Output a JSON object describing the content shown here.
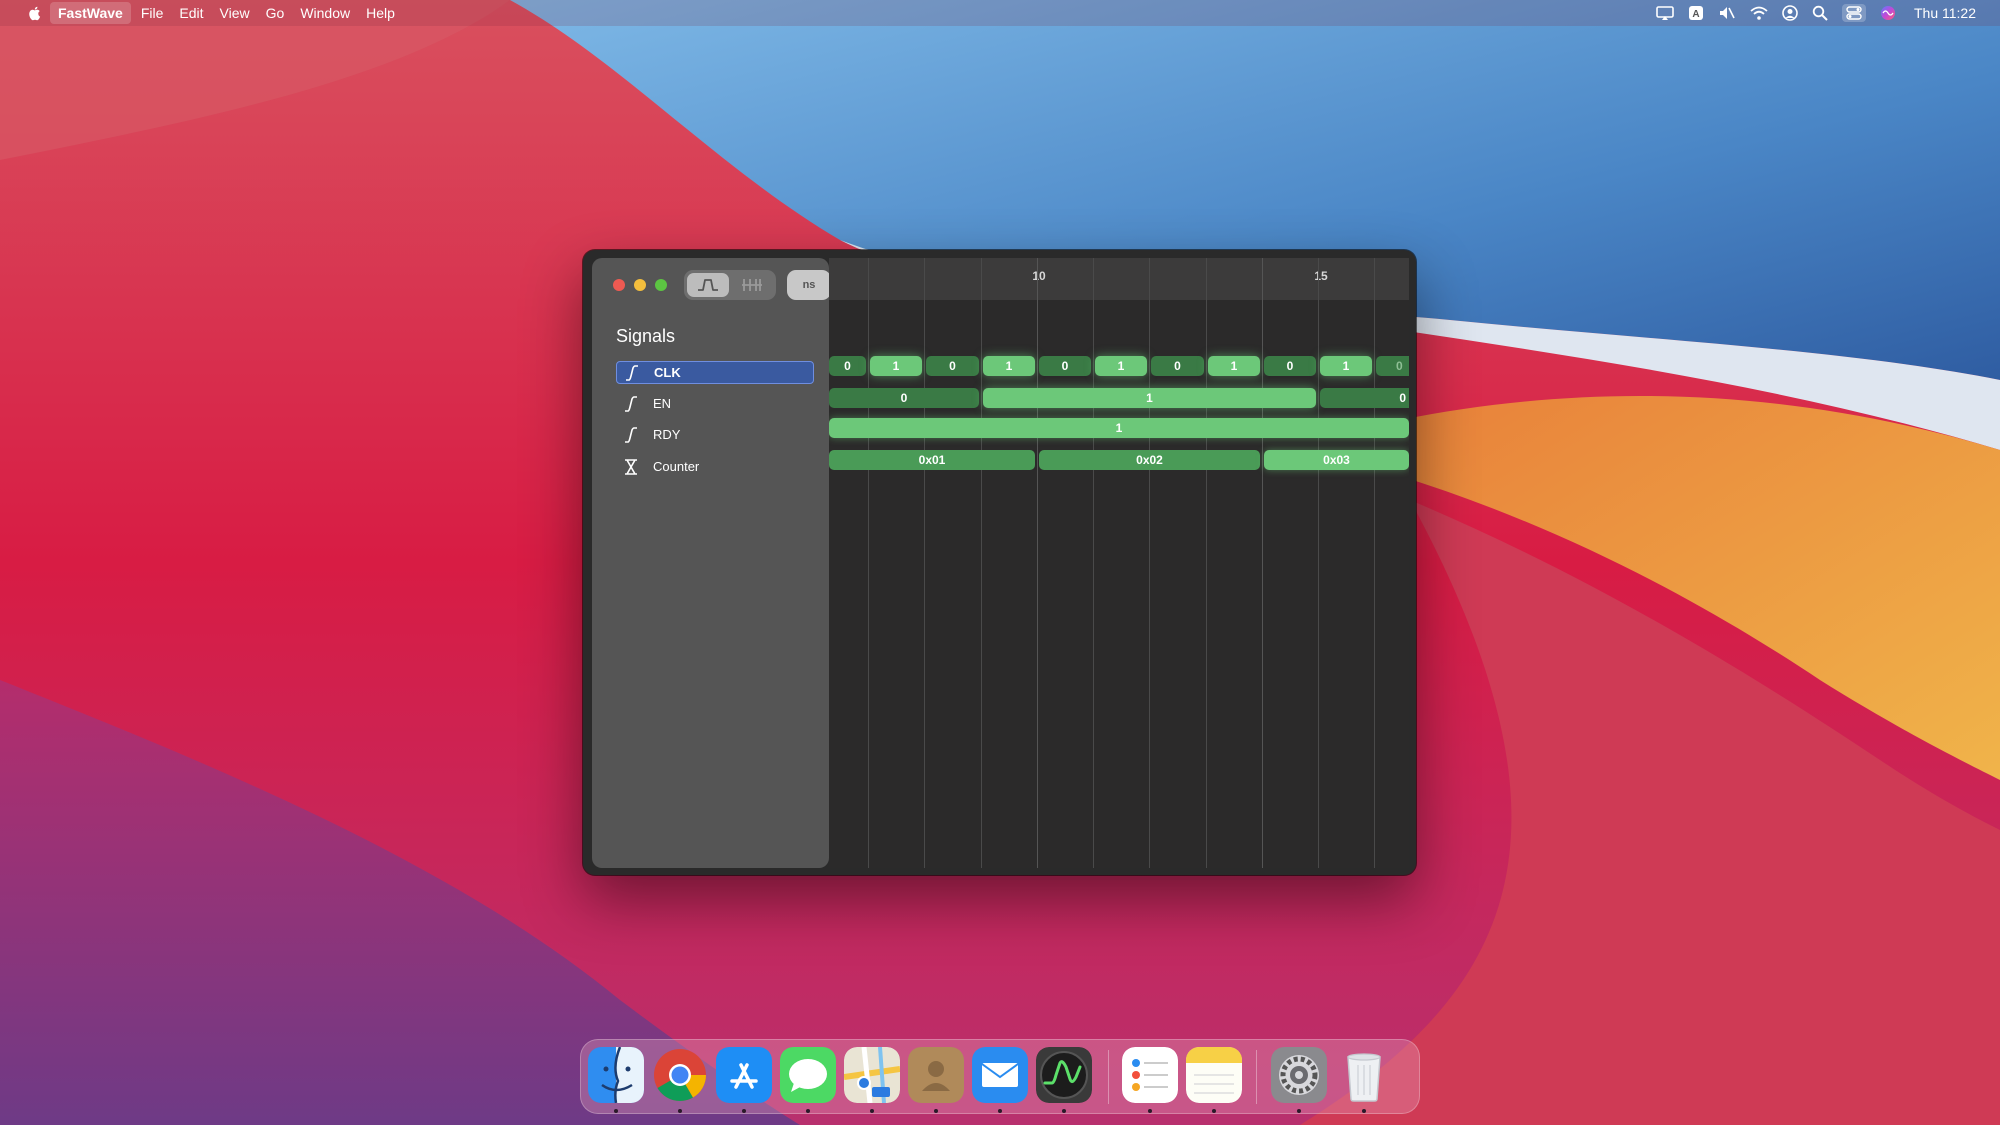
{
  "menubar": {
    "app_name": "FastWave",
    "menus": [
      "File",
      "Edit",
      "View",
      "Go",
      "Window",
      "Help"
    ],
    "clock": "Thu 11:22",
    "status_icons": [
      "screen-mirroring-icon",
      "keyboard-input-icon",
      "muted-volume-icon",
      "wifi-icon",
      "user-account-icon",
      "spotlight-search-icon",
      "control-center-icon",
      "siri-icon"
    ]
  },
  "window": {
    "toolbar": {
      "waveform_view_icon": "waveform-icon",
      "bus_view_icon": "bus-view-icon",
      "time_unit": "ns"
    },
    "sidebar": {
      "title": "Signals",
      "signals": [
        {
          "label": "CLK",
          "icon": "clock-signal-icon",
          "selected": true
        },
        {
          "label": "EN",
          "icon": "edge-signal-icon",
          "selected": false
        },
        {
          "label": "RDY",
          "icon": "edge-signal-icon",
          "selected": false
        },
        {
          "label": "Counter",
          "icon": "bus-signal-icon",
          "selected": false
        }
      ]
    },
    "ruler": {
      "labels": [
        "10",
        "15"
      ]
    },
    "waveforms": {
      "clk": [
        "0",
        "1",
        "0",
        "1",
        "0",
        "1",
        "0",
        "1",
        "0",
        "1",
        "0"
      ],
      "en": [
        "0",
        "1",
        "0"
      ],
      "rdy": [
        "1"
      ],
      "counter": [
        "0x01",
        "0x02",
        "0x03"
      ]
    }
  },
  "dock": {
    "apps": [
      "finder-icon",
      "chrome-icon",
      "app-store-icon",
      "messages-icon",
      "maps-icon",
      "contacts-icon",
      "mail-icon",
      "fastwave-icon",
      "reminders-icon",
      "notes-icon",
      "system-preferences-icon",
      "trash-icon"
    ]
  },
  "colors": {
    "accent_high": "#6cc879",
    "accent_low": "#3a7a45",
    "selection": "#3a5aa0"
  }
}
